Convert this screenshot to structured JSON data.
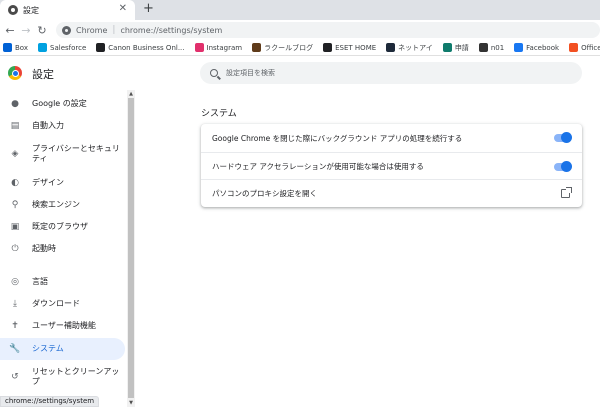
{
  "tab": {
    "title": "設定",
    "close": "✕"
  },
  "newtab": "+",
  "toolbar": {
    "back": "←",
    "forward": "→",
    "reload": "↻"
  },
  "omnibox": {
    "chrome": "Chrome",
    "separator": "|",
    "url": "chrome://settings/system"
  },
  "bookmarks": [
    {
      "label": "Box",
      "color": "#0061d5"
    },
    {
      "label": "Salesforce",
      "color": "#00a1e0"
    },
    {
      "label": "Canon Business Onl...",
      "color": "#202124"
    },
    {
      "label": "Instagram",
      "color": "#e1306c"
    },
    {
      "label": "ラクールブログ",
      "color": "#5f3b1a"
    },
    {
      "label": "ESET HOME",
      "color": "#202124"
    },
    {
      "label": "ネットアイ",
      "color": "#1e2a3a"
    },
    {
      "label": "申請",
      "color": "#0f7b6c"
    },
    {
      "label": "n01",
      "color": "#333333"
    },
    {
      "label": "Facebook",
      "color": "#1877f2"
    },
    {
      "label": "Office TANAKA - Ex...",
      "color": "#f25022"
    }
  ],
  "header": {
    "title": "設定",
    "search_placeholder": "設定項目を検索"
  },
  "sidebar": {
    "items": [
      {
        "icon": "person-icon",
        "glyph": "●",
        "label": "Google の設定"
      },
      {
        "icon": "clipboard-icon",
        "glyph": "▤",
        "label": "自動入力"
      },
      {
        "icon": "shield-icon",
        "glyph": "◈",
        "label": "プライバシーとセキュリティ"
      },
      {
        "icon": "palette-icon",
        "glyph": "◐",
        "label": "デザイン"
      },
      {
        "icon": "search-icon",
        "glyph": "⚲",
        "label": "検索エンジン"
      },
      {
        "icon": "browser-icon",
        "glyph": "▣",
        "label": "既定のブラウザ"
      },
      {
        "icon": "power-icon",
        "glyph": "⏻",
        "label": "起動時"
      },
      {
        "icon": "globe-icon",
        "glyph": "◎",
        "label": "言語"
      },
      {
        "icon": "download-icon",
        "glyph": "⤓",
        "label": "ダウンロード"
      },
      {
        "icon": "accessibility-icon",
        "glyph": "✝",
        "label": "ユーザー補助機能"
      },
      {
        "icon": "wrench-icon",
        "glyph": "🔧",
        "label": "システム"
      },
      {
        "icon": "history-icon",
        "glyph": "↺",
        "label": "リセットとクリーンアップ"
      }
    ],
    "active_index": 10
  },
  "main": {
    "section_title": "システム",
    "rows": [
      {
        "label": "Google Chrome を閉じた際にバックグラウンド アプリの処理を続行する",
        "control": "toggle",
        "on": true
      },
      {
        "label": "ハードウェア アクセラレーションが使用可能な場合は使用する",
        "control": "toggle",
        "on": true
      },
      {
        "label": "パソコンのプロキシ設定を開く",
        "control": "external-link"
      }
    ]
  },
  "statusbar": {
    "text": "chrome://settings/system"
  },
  "colors": {
    "accent": "#1a73e8",
    "active_bg": "#e8f0fe",
    "toggle_track": "#8ab4f8"
  }
}
